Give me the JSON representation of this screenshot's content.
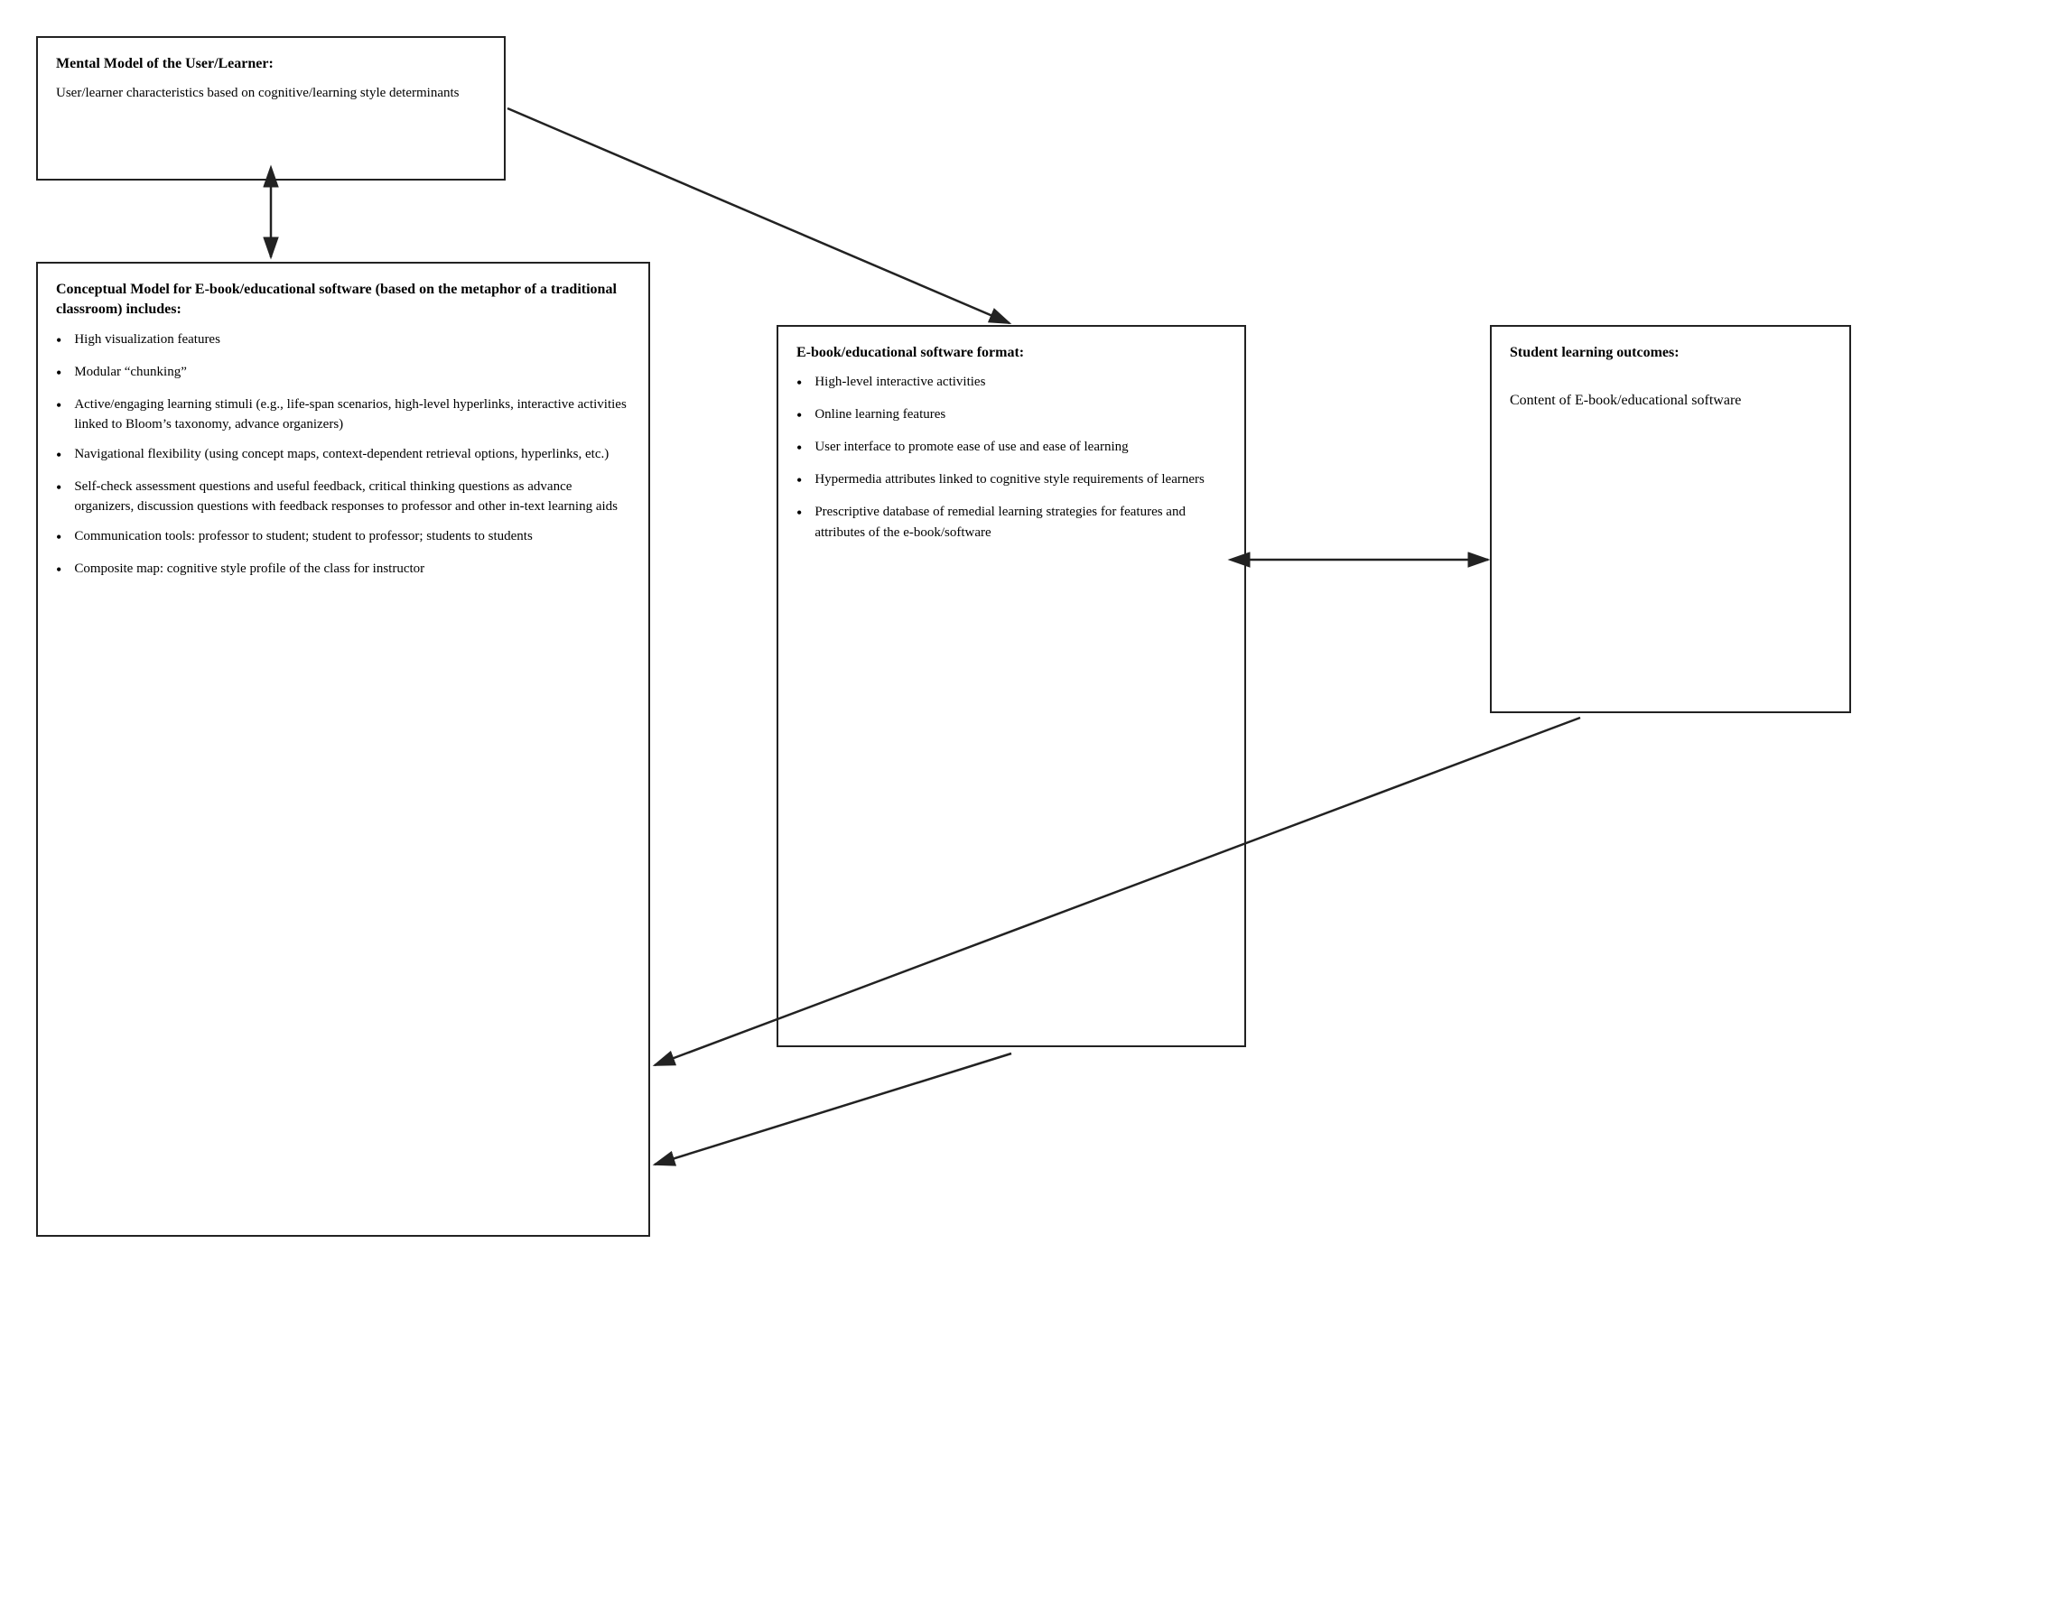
{
  "mental_model": {
    "title": "Mental Model of the User/Learner:",
    "body": "User/learner characteristics based on cognitive/learning style determinants"
  },
  "conceptual_model": {
    "title": "Conceptual Model for E-book/educational software (based on the metaphor of a traditional classroom) includes:",
    "bullets": [
      "High visualization features",
      "Modular “chunking”",
      "Active/engaging learning stimuli (e.g., life-span scenarios, high-level hyperlinks, interactive activities linked to Bloom’s taxonomy, advance organizers)",
      "Navigational flexibility (using concept maps, context-dependent retrieval options, hyperlinks, etc.)",
      "Self-check assessment questions and useful feedback, critical thinking questions as advance organizers, discussion questions with feedback responses to professor and other in-text learning aids",
      "Communication tools: professor to student; student to professor; students to students",
      "Composite map: cognitive style profile of the class for instructor"
    ]
  },
  "ebook_format": {
    "title": "E-book/educational software format:",
    "bullets": [
      "High-level interactive activities",
      "Online learning features",
      "User interface to promote ease of use and ease of learning",
      "Hypermedia attributes linked to cognitive style requirements of learners",
      "Prescriptive database of remedial learning strategies for features and attributes of the e-book/software"
    ]
  },
  "student_learning": {
    "title": "Student learning outcomes:",
    "body": "Content of E-book/educational software"
  }
}
